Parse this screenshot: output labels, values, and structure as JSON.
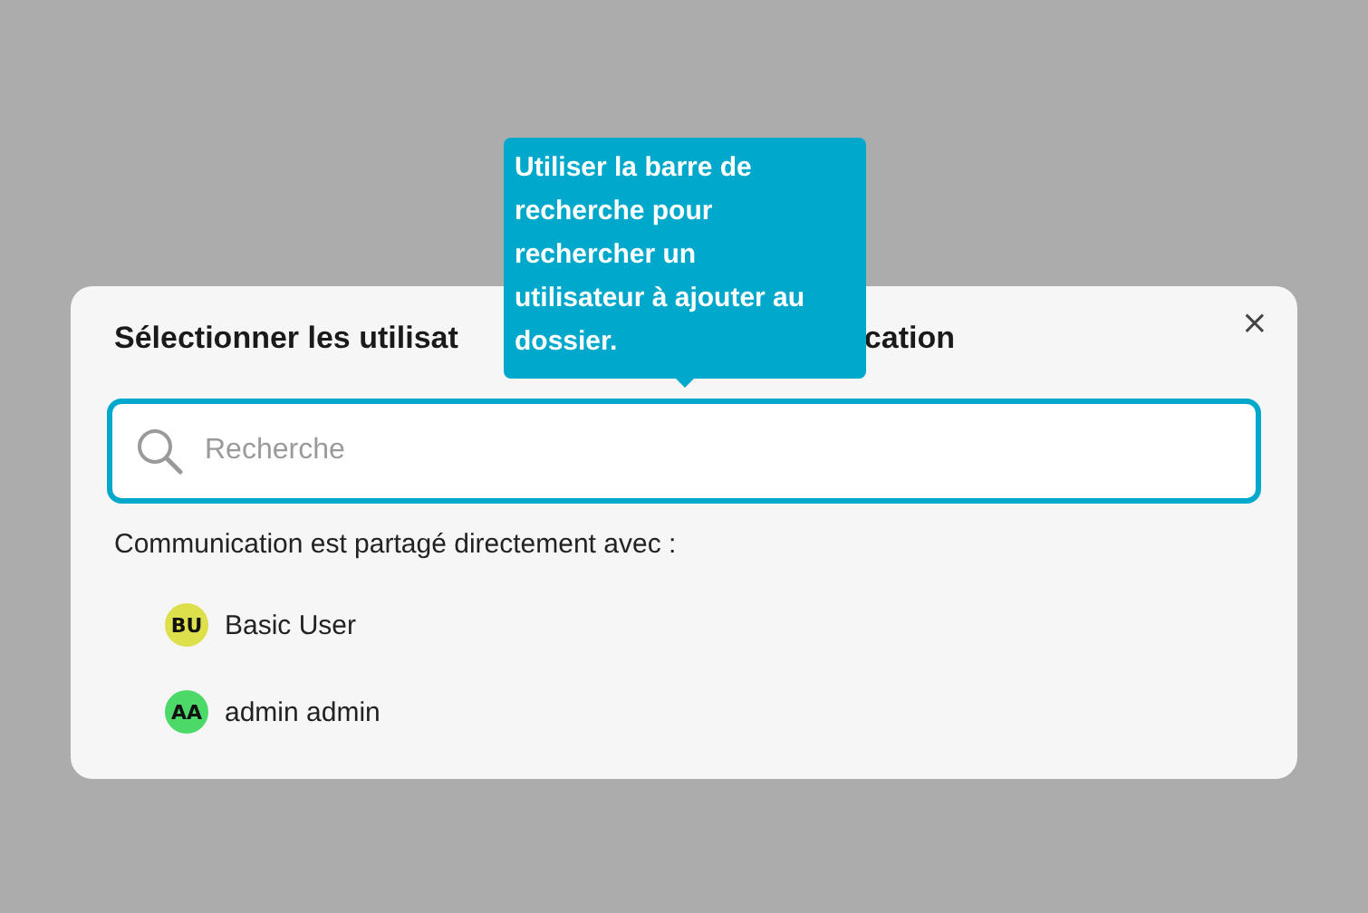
{
  "dialog": {
    "title_visible_start": "Sélectionner les utilisat",
    "title_visible_end": "cation",
    "close": "×",
    "search": {
      "placeholder": "Recherche"
    },
    "shared_label": "Communication est partagé directement avec :",
    "users": [
      {
        "initials": "BU",
        "name": "Basic User",
        "color": "#dde04a"
      },
      {
        "initials": "AA",
        "name": "admin admin",
        "color": "#4cd968"
      }
    ]
  },
  "tooltip": {
    "lines": [
      "Utiliser la barre de",
      "recherche pour",
      "rechercher un",
      "utilisateur à ajouter au",
      "dossier."
    ]
  }
}
